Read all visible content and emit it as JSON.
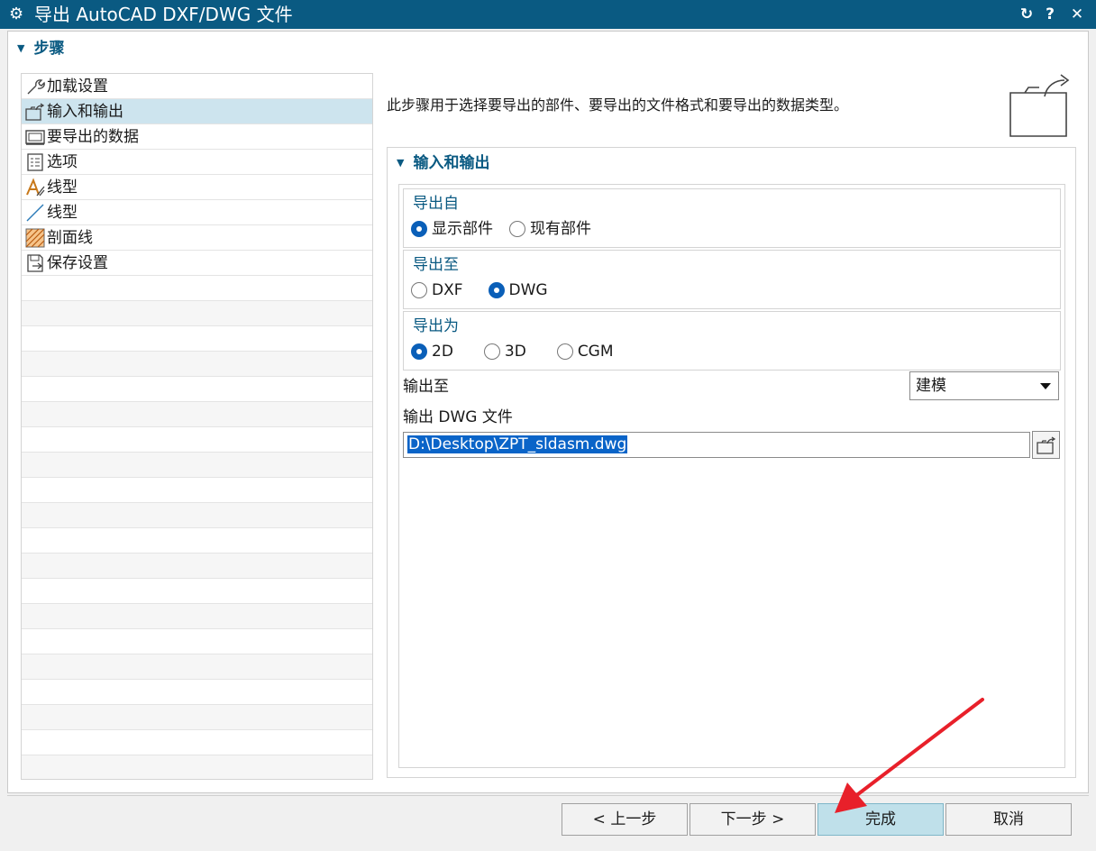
{
  "window": {
    "title": "导出 AutoCAD DXF/DWG 文件",
    "buttons": {
      "reset": "↻",
      "help": "?",
      "close": "✕"
    }
  },
  "steps": {
    "header": "步骤",
    "items": [
      {
        "label": "加载设置",
        "icon": "wrench-icon"
      },
      {
        "label": "输入和输出",
        "icon": "folder-export-icon",
        "selected": true
      },
      {
        "label": "要导出的数据",
        "icon": "display-icon"
      },
      {
        "label": "选项",
        "icon": "options-list-icon"
      },
      {
        "label": "线型",
        "icon": "font-style-icon"
      },
      {
        "label": "线型",
        "icon": "line-icon"
      },
      {
        "label": "剖面线",
        "icon": "hatch-icon"
      },
      {
        "label": "保存设置",
        "icon": "save-settings-icon"
      }
    ]
  },
  "description": "此步骤用于选择要导出的部件、要导出的文件格式和要导出的数据类型。",
  "io": {
    "header": "输入和输出",
    "export_from": {
      "title": "导出自",
      "options": [
        {
          "label": "显示部件",
          "checked": true
        },
        {
          "label": "现有部件",
          "checked": false
        }
      ]
    },
    "export_to": {
      "title": "导出至",
      "options": [
        {
          "label": "DXF",
          "checked": false
        },
        {
          "label": "DWG",
          "checked": true
        }
      ]
    },
    "export_as": {
      "title": "导出为",
      "options": [
        {
          "label": "2D",
          "checked": true
        },
        {
          "label": "3D",
          "checked": false
        },
        {
          "label": "CGM",
          "checked": false
        }
      ]
    },
    "output_to": {
      "label": "输出至",
      "value": "建模"
    },
    "output_file": {
      "label": "输出 DWG 文件",
      "value": "D:\\Desktop\\ZPT_sldasm.dwg"
    }
  },
  "footer": {
    "back": "< 上一步",
    "next": "下一步 >",
    "finish": "完成",
    "cancel": "取消"
  },
  "colors": {
    "titlebar": "#0a5a82",
    "accent": "#0a5fb8",
    "selected_row": "#cde4ee",
    "annotation_arrow": "#e8202a"
  }
}
